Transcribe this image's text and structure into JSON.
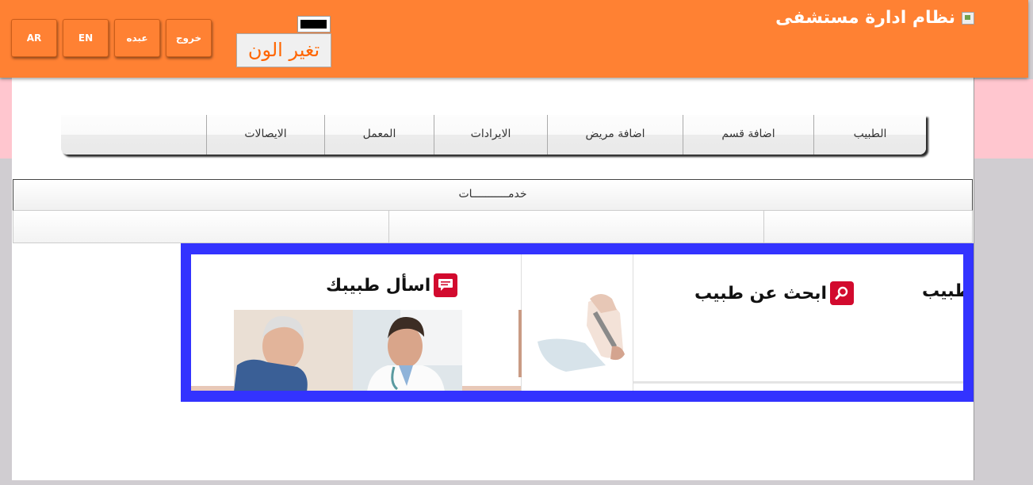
{
  "header": {
    "title": "نظام ادارة مستشفى",
    "buttons": [
      {
        "id": "ar",
        "label": "AR"
      },
      {
        "id": "en",
        "label": "EN"
      },
      {
        "id": "user",
        "label": "عبده"
      },
      {
        "id": "logout",
        "label": "خروج"
      }
    ],
    "color_change_label": "تغير الون",
    "brand_color": "#ff8133"
  },
  "nav": {
    "items": [
      "الطبيب",
      "اضافة قسم",
      "اضافة مريض",
      "الايرادات",
      "المعمل",
      "الايصالات"
    ]
  },
  "services": {
    "title": "خدمـــــــــــات"
  },
  "banner": {
    "border_color": "#3333ff",
    "card_ask": {
      "title": "اسأل طبيبك",
      "icon": "chat-icon"
    },
    "card_search": {
      "title": "ابحث عن طبيب",
      "icon": "search-icon"
    },
    "card_partial": {
      "title": "طبيب"
    }
  }
}
